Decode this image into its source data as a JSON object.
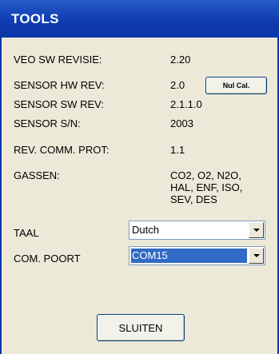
{
  "window": {
    "title": "TOOLS"
  },
  "info": {
    "veo_sw_revisie_label": "VEO SW REVISIE:",
    "veo_sw_revisie_value": "2.20",
    "sensor_hw_rev_label": "SENSOR HW REV:",
    "sensor_hw_rev_value": "2.0",
    "sensor_sw_rev_label": "SENSOR SW REV:",
    "sensor_sw_rev_value": "2.1.1.0",
    "sensor_sn_label": "SENSOR S/N:",
    "sensor_sn_value": "2003",
    "rev_comm_prot_label": "REV. COMM. PROT:",
    "rev_comm_prot_value": "1.1",
    "gassen_label": "GASSEN:",
    "gassen_lines": [
      "CO2, O2, N2O,",
      "HAL, ENF, ISO,",
      "SEV, DES"
    ]
  },
  "buttons": {
    "nulcal_label": "Nul Cal.",
    "sluiten_label": "SLUITEN"
  },
  "settings": {
    "taal_label": "TAAL",
    "taal_value": "Dutch",
    "com_poort_label": "COM. POORT",
    "com_poort_value": "COM15"
  },
  "colors": {
    "titlebar": "#0b36a9",
    "window_bg": "#ece9d8",
    "selection": "#316ac5"
  }
}
